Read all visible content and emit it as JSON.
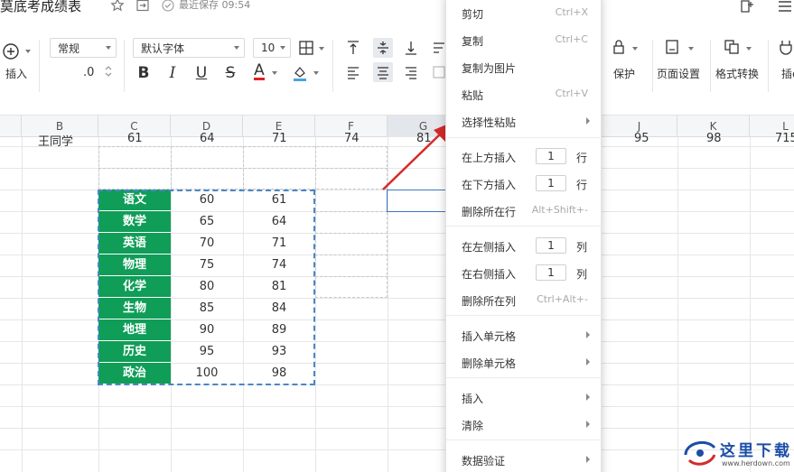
{
  "title_bar": {
    "doc_title": "莫底考成绩表",
    "save_status": "最近保存 09:54"
  },
  "toolbar": {
    "insert_label": "插入",
    "number_format": "常规",
    "decimal_value": ".0",
    "font_name": "默认字体",
    "font_size": "10",
    "protect_label": "保护",
    "page_setup_label": "页面设置",
    "format_convert_label": "格式转换",
    "insert_right_label": "插e"
  },
  "columns": [
    "B",
    "C",
    "D",
    "E",
    "F",
    "G",
    "",
    "",
    "J",
    "K",
    "L"
  ],
  "partial_row": {
    "b": "王同学",
    "c": "61",
    "d": "64",
    "e": "71",
    "f": "74",
    "g": "81",
    "j": "95",
    "k": "98",
    "l": "715"
  },
  "table": {
    "subjects": [
      "语文",
      "数学",
      "英语",
      "物理",
      "化学",
      "生物",
      "地理",
      "历史",
      "政治"
    ],
    "col_d": [
      "60",
      "65",
      "70",
      "75",
      "80",
      "85",
      "90",
      "95",
      "100"
    ],
    "col_e": [
      "61",
      "64",
      "71",
      "74",
      "81",
      "84",
      "89",
      "93",
      "98"
    ]
  },
  "context_menu": {
    "cut": "剪切",
    "cut_shortcut": "Ctrl+X",
    "copy": "复制",
    "copy_shortcut": "Ctrl+C",
    "copy_as_image": "复制为图片",
    "paste": "粘贴",
    "paste_shortcut": "Ctrl+V",
    "paste_special": "选择性粘贴",
    "insert_row_above": "在上方插入",
    "insert_row_above_count": "1",
    "row_unit": "行",
    "insert_row_below": "在下方插入",
    "insert_row_below_count": "1",
    "delete_row": "删除所在行",
    "delete_row_shortcut": "Alt+Shift+-",
    "insert_col_left": "在左侧插入",
    "insert_col_left_count": "1",
    "col_unit": "列",
    "insert_col_right": "在右侧插入",
    "insert_col_right_count": "1",
    "delete_col": "删除所在列",
    "delete_col_shortcut": "Ctrl+Alt+-",
    "insert_cells": "插入单元格",
    "delete_cells": "删除单元格",
    "insert": "插入",
    "clear": "清除",
    "data_validation": "数据验证"
  },
  "watermark": {
    "main": "这里下载",
    "url": "www.herdown.com"
  },
  "colors": {
    "subject_green": "#0f9d58",
    "selection_blue": "#4a86c7",
    "arrow_red": "#d42a2a",
    "watermark_blue": "#1b4ea8"
  }
}
